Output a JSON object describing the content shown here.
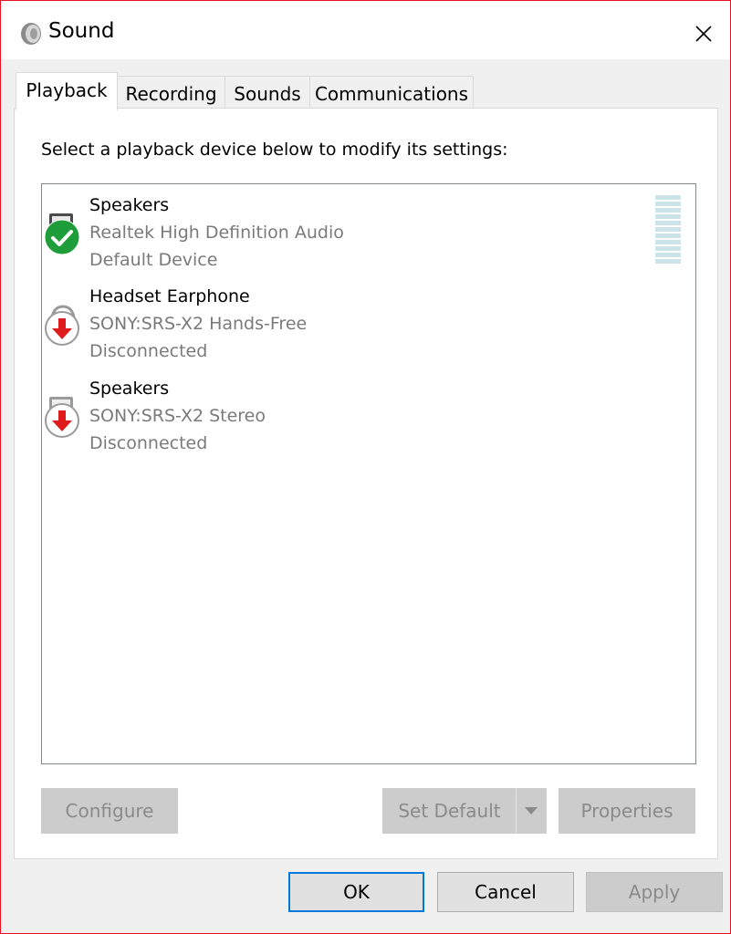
{
  "window": {
    "title": "Sound"
  },
  "tabs": [
    {
      "label": "Playback",
      "active": true
    },
    {
      "label": "Recording",
      "active": false
    },
    {
      "label": "Sounds",
      "active": false
    },
    {
      "label": "Communications",
      "active": false
    }
  ],
  "playback": {
    "instruction": "Select a playback device below to modify its settings:",
    "devices": [
      {
        "name": "Speakers",
        "description": "Realtek High Definition Audio",
        "status": "Default Device",
        "icon": "speaker-icon",
        "badge": "check-badge-icon"
      },
      {
        "name": "Headset Earphone",
        "description": "SONY:SRS-X2 Hands-Free",
        "status": "Disconnected",
        "icon": "headset-icon",
        "badge": "disconnected-badge-icon"
      },
      {
        "name": "Speakers",
        "description": "SONY:SRS-X2 Stereo",
        "status": "Disconnected",
        "icon": "speaker-icon",
        "badge": "disconnected-badge-icon"
      }
    ],
    "buttons": {
      "configure": "Configure",
      "set_default": "Set Default",
      "properties": "Properties"
    }
  },
  "footer": {
    "ok": "OK",
    "cancel": "Cancel",
    "apply": "Apply"
  },
  "colors": {
    "focus_blue": "#0078d7",
    "close_border": "#e81123",
    "default_green": "#1e9e3a",
    "disconnected_red": "#e01b1b",
    "level_meter": "#cde3ea"
  }
}
